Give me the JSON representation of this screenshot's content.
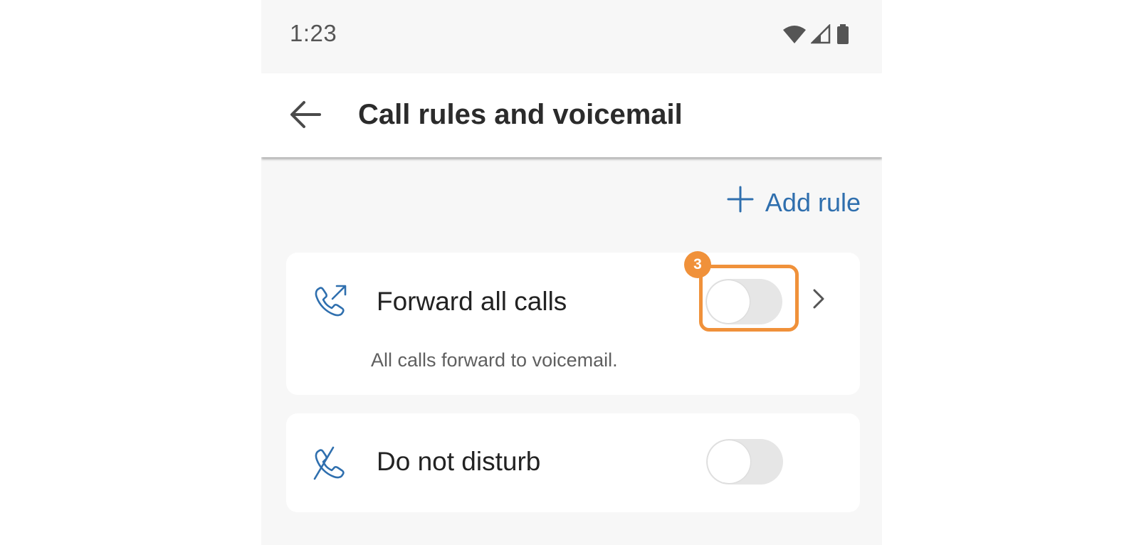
{
  "status_bar": {
    "time": "1:23",
    "icons": [
      "wifi-icon",
      "signal-icon",
      "battery-icon"
    ]
  },
  "app_bar": {
    "back_icon": "arrow-left-icon",
    "title": "Call rules and voicemail"
  },
  "actions": {
    "add_rule_icon": "plus-icon",
    "add_rule_label": "Add rule"
  },
  "rules": {
    "forward": {
      "icon": "phone-forward-icon",
      "title": "Forward all calls",
      "subtitle": "All calls forward to voicemail.",
      "enabled": false,
      "step_badge": "3"
    },
    "dnd": {
      "icon": "phone-muted-icon",
      "title": "Do not disturb",
      "enabled": false
    }
  },
  "colors": {
    "accent_blue": "#2f6fae",
    "highlight_orange": "#f0913a",
    "background": "#f7f7f7",
    "toggle_off": "#e6e6e6"
  }
}
